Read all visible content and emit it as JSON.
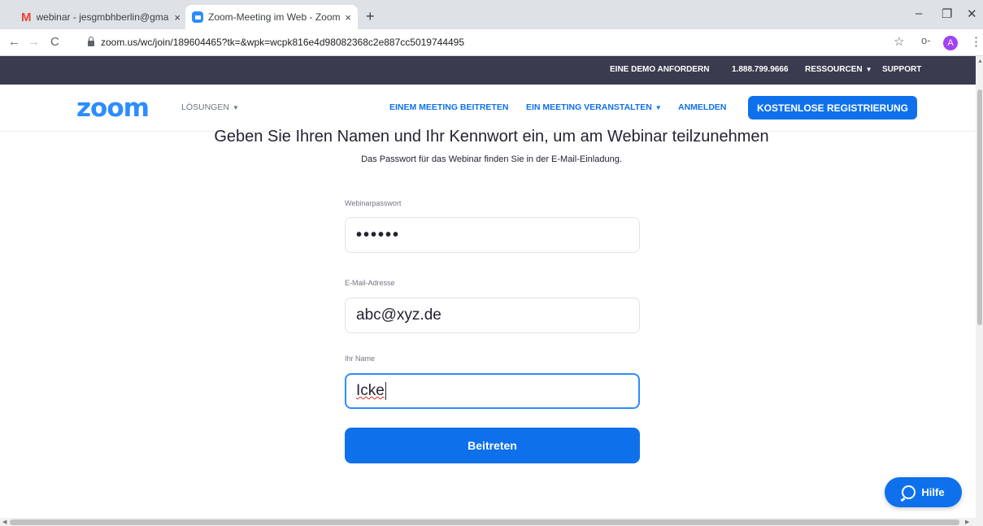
{
  "browser": {
    "tabs": [
      {
        "title": "webinar - jesgmbhberlin@gmail.",
        "close": "×"
      },
      {
        "title": "Zoom-Meeting im Web - Zoom",
        "close": "×"
      }
    ],
    "new_tab": "+",
    "window_controls": {
      "minimize": "–",
      "restore": "❐",
      "close": "✕"
    },
    "url": "zoom.us/wc/join/189604465?tk=&wpk=wcpk816e4d98082368c2e887cc5019744495",
    "profile_initial": "A",
    "icons": {
      "back": "←",
      "forward": "→",
      "reload": "C",
      "star": "☆",
      "key": "o-",
      "menu": "⋮"
    }
  },
  "topbar": {
    "demo": "EINE DEMO ANFORDERN",
    "phone": "1.888.799.9666",
    "resources": "RESSOURCEN",
    "support": "SUPPORT"
  },
  "nav": {
    "logo": "zoom",
    "solutions": "LÖSUNGEN",
    "join_meeting": "EINEM MEETING BEITRETEN",
    "host_meeting": "EIN MEETING VERANSTALTEN",
    "sign_in": "ANMELDEN",
    "register": "KOSTENLOSE REGISTRIERUNG"
  },
  "form": {
    "heading": "Geben Sie Ihren Namen und Ihr Kennwort ein, um am Webinar teilzunehmen",
    "subheading": "Das Passwort für das Webinar finden Sie in der E-Mail-Einladung.",
    "password_label": "Webinarpasswort",
    "password_value": "••••••",
    "email_label": "E-Mail-Adresse",
    "email_value": "abc@xyz.de",
    "name_label": "Ihr Name",
    "name_value": "Icke",
    "submit": "Beitreten"
  },
  "help": {
    "label": "Hilfe"
  },
  "colors": {
    "accent": "#0e71eb",
    "topbar": "#393b4f",
    "logo": "#2d8cff"
  }
}
